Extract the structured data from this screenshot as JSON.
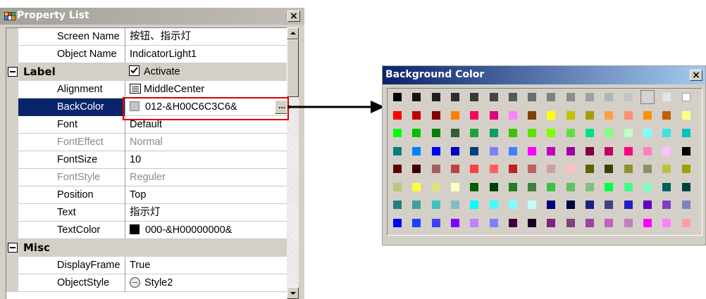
{
  "property_list": {
    "title": "Property List",
    "close_label": "×",
    "rows": [
      {
        "kind": "prop",
        "name": "Screen Name",
        "value": "按钮、指示灯",
        "dim": false
      },
      {
        "kind": "prop",
        "name": "Object Name",
        "value": "IndicatorLight1",
        "dim": false
      },
      {
        "kind": "cat",
        "name": "Label",
        "value": "Activate",
        "value_icon": "checkbox-checked-icon"
      },
      {
        "kind": "prop",
        "name": "Alignment",
        "value": "MiddleCenter",
        "value_icon": "align-center-icon",
        "dim": false
      },
      {
        "kind": "prop",
        "name": "BackColor",
        "value": "012-&H00C6C3C6&",
        "value_icon": "color-swatch-icon",
        "swatch_color": "#c6c3c6",
        "selected": true,
        "has_ellipsis": true,
        "ellipsis_label": "..."
      },
      {
        "kind": "prop",
        "name": "Font",
        "value": "Default",
        "dim": false
      },
      {
        "kind": "prop",
        "name": "FontEffect",
        "value": "Normal",
        "dim": true
      },
      {
        "kind": "prop",
        "name": "FontSize",
        "value": "10",
        "dim": false
      },
      {
        "kind": "prop",
        "name": "FontStyle",
        "value": "Reguler",
        "dim": true
      },
      {
        "kind": "prop",
        "name": "Position",
        "value": "Top",
        "dim": false
      },
      {
        "kind": "prop",
        "name": "Text",
        "value": "指示灯",
        "dim": false
      },
      {
        "kind": "prop",
        "name": "TextColor",
        "value": "000-&H00000000&",
        "value_icon": "color-swatch-icon",
        "swatch_color": "#000000",
        "dim": false
      },
      {
        "kind": "cat",
        "name": "Misc",
        "value": ""
      },
      {
        "kind": "prop",
        "name": "DisplayFrame",
        "value": "True",
        "dim": false
      },
      {
        "kind": "prop",
        "name": "ObjectStyle",
        "value": "Style2",
        "value_icon": "style-circle-icon",
        "dim": false
      }
    ]
  },
  "background_color": {
    "title": "Background Color",
    "close_label": "×",
    "selected_index": 13,
    "palette": [
      "#000000",
      "#141414",
      "#202020",
      "#2c2c2c",
      "#383838",
      "#444444",
      "#585858",
      "#6c6c6c",
      "#808080",
      "#8c8c8c",
      "#a0a0a0",
      "#b4b4b4",
      "#c6c3c6",
      "#d4d4d4",
      "#e4e4e4",
      "#ffffff",
      "#ff0000",
      "#c00000",
      "#800000",
      "#ff8000",
      "#ff0060",
      "#e00080",
      "#ff80ff",
      "#804000",
      "#ffff00",
      "#c0c000",
      "#a0a000",
      "#ffa040",
      "#ff9070",
      "#ff9000",
      "#c06000",
      "#ffff80",
      "#00ff00",
      "#00c000",
      "#008000",
      "#306030",
      "#20a040",
      "#00a060",
      "#40c000",
      "#60e000",
      "#80ff00",
      "#60e040",
      "#00e080",
      "#80ff80",
      "#c0ffc0",
      "#80ffff",
      "#40e0e0",
      "#00c0c0",
      "#008080",
      "#0080ff",
      "#0000ff",
      "#0000c0",
      "#004080",
      "#8080ff",
      "#4080ff",
      "#ff00ff",
      "#c000c0",
      "#a000a0",
      "#800040",
      "#c00060",
      "#ff0080",
      "#ff80c0",
      "#ffc0ff",
      "#000000",
      "#600000",
      "#400000",
      "#a06060",
      "#c04040",
      "#ff4040",
      "#ff6060",
      "#c02020",
      "#c06060",
      "#d0a0a0",
      "#ffc0c0",
      "#606000",
      "#404000",
      "#909030",
      "#909060",
      "#c0c040",
      "#a0a000",
      "#c0c080",
      "#ffff40",
      "#e0e080",
      "#ffffc0",
      "#006000",
      "#004000",
      "#208020",
      "#408040",
      "#40c040",
      "#60c060",
      "#80c080",
      "#00ff40",
      "#40ff80",
      "#80ffc0",
      "#006060",
      "#004040",
      "#208080",
      "#40a0a0",
      "#40c0c0",
      "#80c0c0",
      "#00ffff",
      "#40ffff",
      "#80ffff",
      "#c0ffff",
      "#000080",
      "#000040",
      "#202080",
      "#404080",
      "#2020c0",
      "#6000c0",
      "#8040c0",
      "#8080c0",
      "#0000ff",
      "#2040ff",
      "#4040ff",
      "#8000ff",
      "#c080ff",
      "#8080ff",
      "#400040",
      "#200020",
      "#802080",
      "#804080",
      "#a040a0",
      "#c060c0",
      "#c080c0",
      "#ff00ff",
      "#ff80ff",
      "#ffa0a0"
    ]
  }
}
